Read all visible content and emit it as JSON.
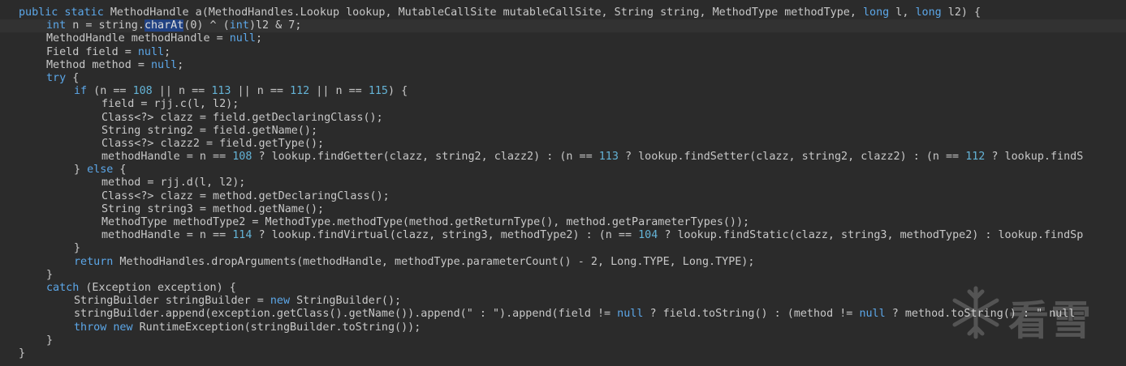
{
  "editor": {
    "lines": [
      {
        "indent": 0,
        "tokens": [
          [
            "kw",
            "public static "
          ],
          [
            "",
            "MethodHandle a(MethodHandles.Lookup lookup, MutableCallSite mutableCallSite, String string, MethodType methodType, "
          ],
          [
            "kw",
            "long"
          ],
          [
            "",
            " l, "
          ],
          [
            "kw",
            "long"
          ],
          [
            "",
            " l2) {"
          ]
        ]
      },
      {
        "indent": 1,
        "tokens": [
          [
            "kw",
            "int"
          ],
          [
            "",
            " n = string."
          ],
          [
            "hl",
            "charAt"
          ],
          [
            "",
            "(0) ^ ("
          ],
          [
            "kw",
            "int"
          ],
          [
            "",
            ")l2 & 7;"
          ]
        ]
      },
      {
        "indent": 1,
        "tokens": [
          [
            "",
            "MethodHandle methodHandle = "
          ],
          [
            "kw",
            "null"
          ],
          [
            "",
            ";"
          ]
        ]
      },
      {
        "indent": 1,
        "tokens": [
          [
            "",
            "Field field = "
          ],
          [
            "kw",
            "null"
          ],
          [
            "",
            ";"
          ]
        ]
      },
      {
        "indent": 1,
        "tokens": [
          [
            "",
            "Method method = "
          ],
          [
            "kw",
            "null"
          ],
          [
            "",
            ";"
          ]
        ]
      },
      {
        "indent": 1,
        "tokens": [
          [
            "kw",
            "try"
          ],
          [
            "",
            " {"
          ]
        ]
      },
      {
        "indent": 2,
        "tokens": [
          [
            "kw",
            "if"
          ],
          [
            "",
            " (n == "
          ],
          [
            "num",
            "108"
          ],
          [
            "",
            " || n == "
          ],
          [
            "num",
            "113"
          ],
          [
            "",
            " || n == "
          ],
          [
            "num",
            "112"
          ],
          [
            "",
            " || n == "
          ],
          [
            "num",
            "115"
          ],
          [
            "",
            ") {"
          ]
        ]
      },
      {
        "indent": 3,
        "tokens": [
          [
            "",
            "field = rjj.c(l, l2);"
          ]
        ]
      },
      {
        "indent": 3,
        "tokens": [
          [
            "",
            "Class<?> clazz = field.getDeclaringClass();"
          ]
        ]
      },
      {
        "indent": 3,
        "tokens": [
          [
            "",
            "String string2 = field.getName();"
          ]
        ]
      },
      {
        "indent": 3,
        "tokens": [
          [
            "",
            "Class<?> clazz2 = field.getType();"
          ]
        ]
      },
      {
        "indent": 3,
        "tokens": [
          [
            "",
            "methodHandle = n == "
          ],
          [
            "num",
            "108"
          ],
          [
            "",
            " ? lookup.findGetter(clazz, string2, clazz2) : (n == "
          ],
          [
            "num",
            "113"
          ],
          [
            "",
            " ? lookup.findSetter(clazz, string2, clazz2) : (n == "
          ],
          [
            "num",
            "112"
          ],
          [
            "",
            " ? lookup.findS"
          ]
        ]
      },
      {
        "indent": 2,
        "tokens": [
          [
            "",
            "} "
          ],
          [
            "kw",
            "else"
          ],
          [
            "",
            " {"
          ]
        ]
      },
      {
        "indent": 3,
        "tokens": [
          [
            "",
            "method = rjj.d(l, l2);"
          ]
        ]
      },
      {
        "indent": 3,
        "tokens": [
          [
            "",
            "Class<?> clazz = method.getDeclaringClass();"
          ]
        ]
      },
      {
        "indent": 3,
        "tokens": [
          [
            "",
            "String string3 = method.getName();"
          ]
        ]
      },
      {
        "indent": 3,
        "tokens": [
          [
            "",
            "MethodType methodType2 = MethodType.methodType(method.getReturnType(), method.getParameterTypes());"
          ]
        ]
      },
      {
        "indent": 3,
        "tokens": [
          [
            "",
            "methodHandle = n == "
          ],
          [
            "num",
            "114"
          ],
          [
            "",
            " ? lookup.findVirtual(clazz, string3, methodType2) : (n == "
          ],
          [
            "num",
            "104"
          ],
          [
            "",
            " ? lookup.findStatic(clazz, string3, methodType2) : lookup.findSp"
          ]
        ]
      },
      {
        "indent": 2,
        "tokens": [
          [
            "",
            "}"
          ]
        ]
      },
      {
        "indent": 2,
        "tokens": [
          [
            "kw",
            "return"
          ],
          [
            "",
            " MethodHandles.dropArguments(methodHandle, methodType.parameterCount() - 2, Long.TYPE, Long.TYPE);"
          ]
        ]
      },
      {
        "indent": 1,
        "tokens": [
          [
            "",
            "}"
          ]
        ]
      },
      {
        "indent": 1,
        "tokens": [
          [
            "kw",
            "catch"
          ],
          [
            "",
            " (Exception exception) {"
          ]
        ]
      },
      {
        "indent": 2,
        "tokens": [
          [
            "",
            "StringBuilder stringBuilder = "
          ],
          [
            "kw",
            "new"
          ],
          [
            "",
            " StringBuilder();"
          ]
        ]
      },
      {
        "indent": 2,
        "tokens": [
          [
            "",
            "stringBuilder.append(exception.getClass().getName()).append(\" : \").append(field != "
          ],
          [
            "kw",
            "null"
          ],
          [
            "",
            " ? field.toString() : (method != "
          ],
          [
            "kw",
            "null"
          ],
          [
            "",
            " ? method.toString() : \" null"
          ]
        ]
      },
      {
        "indent": 2,
        "tokens": [
          [
            "kw",
            "throw"
          ],
          [
            "",
            " "
          ],
          [
            "kw",
            "new"
          ],
          [
            "",
            " RuntimeException(stringBuilder.toString());"
          ]
        ]
      },
      {
        "indent": 1,
        "tokens": [
          [
            "",
            "}"
          ]
        ]
      },
      {
        "indent": 0,
        "tokens": [
          [
            "",
            "}"
          ]
        ]
      }
    ],
    "active_line": 1
  },
  "watermark": {
    "text": "看雪",
    "icon": "snowflake-icon"
  }
}
